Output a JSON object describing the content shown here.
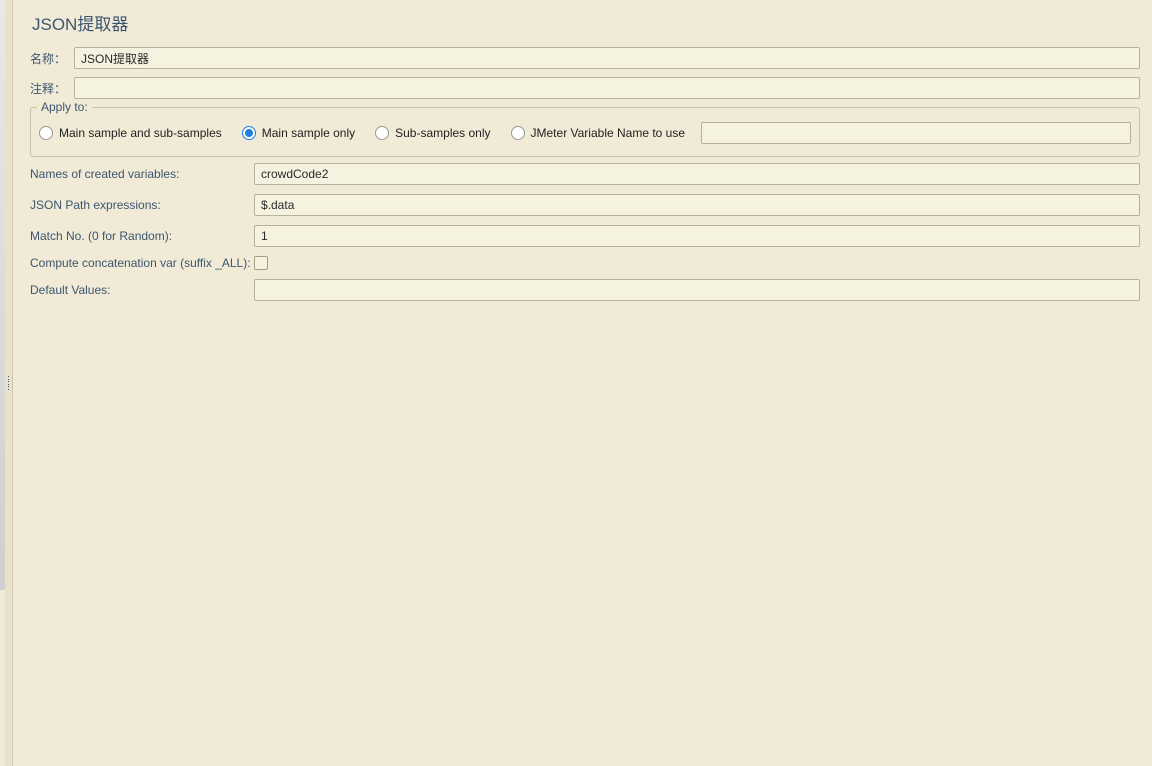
{
  "panel_title": "JSON提取器",
  "name_row": {
    "label": "名称：",
    "value": "JSON提取器"
  },
  "comment_row": {
    "label": "注释：",
    "value": ""
  },
  "apply_to": {
    "legend": "Apply to:",
    "options": [
      {
        "label": "Main sample and sub-samples",
        "checked": false
      },
      {
        "label": "Main sample only",
        "checked": true
      },
      {
        "label": "Sub-samples only",
        "checked": false
      },
      {
        "label": "JMeter Variable Name to use",
        "checked": false
      }
    ],
    "var_value": ""
  },
  "fields": {
    "names_of_vars": {
      "label": "Names of created variables:",
      "value": "crowdCode2"
    },
    "json_path": {
      "label": "JSON Path expressions:",
      "value": "$.data"
    },
    "match_no": {
      "label": "Match No. (0 for Random):",
      "value": "1"
    },
    "compute_all": {
      "label": "Compute concatenation var (suffix _ALL):",
      "checked": false
    },
    "default_values": {
      "label": "Default Values:",
      "value": ""
    }
  }
}
